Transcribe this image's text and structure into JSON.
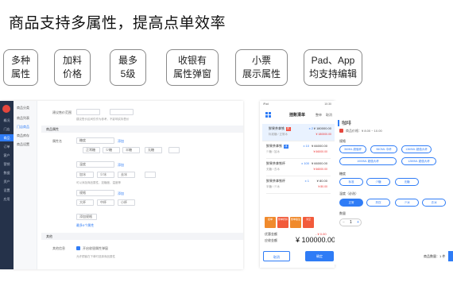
{
  "headline": "商品支持多属性，提高点单效率",
  "features": [
    {
      "line1": "多种",
      "line2": "属性"
    },
    {
      "line1": "加料",
      "line2": "价格"
    },
    {
      "line1": "最多",
      "line2": "5级"
    },
    {
      "line1": "收银有",
      "line2": "属性弹窗"
    },
    {
      "line1": "小票",
      "line2": "展示属性"
    },
    {
      "line1": "Pad、App",
      "line2": "均支持编辑"
    }
  ],
  "admin": {
    "rail_items": [
      "概况",
      "门店",
      "商品",
      "订单",
      "客户",
      "营销",
      "数据",
      "资产",
      "设置",
      "应用"
    ],
    "subnav": [
      "商品分类",
      "商品列表",
      "门店商品",
      "商品库存",
      "商品设置"
    ],
    "sections": {
      "attr": "商品属性",
      "other": "其他"
    },
    "labels": {
      "price_range": "建议售价范围",
      "attr_name": "属性名",
      "extra": "其他信息"
    },
    "values": {
      "sugar": "糖度",
      "temp": "温度",
      "size": "规格"
    },
    "options": [
      "正常糖",
      "少糖",
      "半糖",
      "无糖",
      "加冰",
      "少冰",
      "去冰",
      "大杯",
      "中杯",
      "小杯"
    ],
    "links": {
      "add": "添加",
      "add_group": "添加规格",
      "tip": "最多5个属性"
    },
    "notes": {
      "range": "建议售价区间仅作为参考，不影响实际售价",
      "attr_tip": "可以添加商品属性，如糖度、温度等",
      "other_tip": "允许顾客在下单时选择商品属性"
    },
    "check_label": "开启收银属性弹窗"
  },
  "tablet": {
    "status_left": "iPad",
    "status_right": "10:30",
    "title": "挂账清单",
    "header_actions": [
      "整单",
      "取消"
    ],
    "orders": [
      {
        "name": "鲜果茶拿铁",
        "tag": "热",
        "sub": "标准糖 / 正常冰",
        "qty": "x 2",
        "price": "¥ 180000.00",
        "price2": "¥ 180000.00"
      },
      {
        "name": "鲜果茶拿铁",
        "tag": "冰",
        "sub": "少糖 / 加冰",
        "qty": "x 10",
        "price": "¥ 66000.00",
        "price2": "¥ 66000.00"
      },
      {
        "name": "鲜果茶拿铁杯",
        "tag": "",
        "sub": "无糖 / 去冰",
        "qty": "x 100",
        "price": "¥ 66000.00",
        "price2": "¥ 66000.00"
      },
      {
        "name": "鲜果茶拿铁杯",
        "tag": "",
        "sub": "半糖 / 少冰",
        "qty": "x 1",
        "price": "¥ 80.00",
        "price2": "¥ 80.00"
      }
    ],
    "functions": [
      "挂单",
      "整单折扣",
      "整单备注",
      "清空"
    ],
    "discount_label": "优惠金额",
    "discount_value": "- ¥ 0.00",
    "total_label": "应收金额",
    "total_value": "¥ 100000.00",
    "buttons": {
      "left": "取消",
      "right": "确定"
    }
  },
  "popup": {
    "title": "咖啡",
    "price": "商品价格：¥ 8.00 ~ 10.00",
    "group1": "规格",
    "chips1": [
      "360ML 超值杯",
      "96OML 中杯",
      "1360ML 超值大杯",
      "1000ML 超值大杯",
      "1280ML 超值大杯"
    ],
    "group2": "糖度",
    "chips2": [
      "标准",
      "少糖",
      "无糖"
    ],
    "group3": "温度（必选）",
    "chips3": [
      "正常",
      "热饮",
      "少冰",
      "去冰"
    ],
    "group4": "数量",
    "qty": "1",
    "count_text": "商品数量：1 件"
  },
  "colors": {
    "accent": "#2f7cf6",
    "nav": "#25324a",
    "alert": "#e5473d"
  },
  "icons": {
    "grid": "grid-icon",
    "logo": "app-logo-icon",
    "check": "checkbox-icon"
  }
}
